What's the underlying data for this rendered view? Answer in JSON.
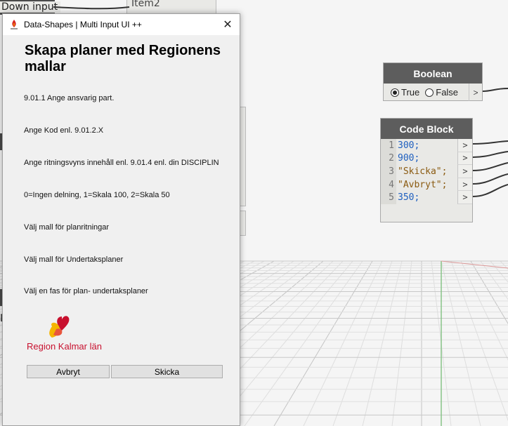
{
  "canvas": {
    "stub_labels": {
      "down_input_top": "Down input",
      "item_top": "Item2",
      "down_input_side": "Do"
    },
    "boolean_node": {
      "title": "Boolean",
      "true_label": "True",
      "false_label": "False",
      "selected": "True",
      "out_port": ">"
    },
    "code_block_node": {
      "title": "Code Block",
      "lines": [
        {
          "number": "1",
          "code": "300;",
          "kind": "num",
          "port": ">"
        },
        {
          "number": "2",
          "code": "900;",
          "kind": "num",
          "port": ">"
        },
        {
          "number": "3",
          "code": "\"Skicka\";",
          "kind": "str",
          "port": ">"
        },
        {
          "number": "4",
          "code": "\"Avbryt\";",
          "kind": "str",
          "port": ">"
        },
        {
          "number": "5",
          "code": "350;",
          "kind": "num",
          "port": ">"
        }
      ]
    }
  },
  "dialog": {
    "title": "Data-Shapes | Multi Input UI ++",
    "close_label": "✕",
    "heading": "Skapa planer med Regionens mallar",
    "fields": [
      "9.01.1 Ange ansvarig part.",
      "Ange Kod enl. 9.01.2.X",
      "Ange ritningsvyns innehåll enl. 9.01.4 enl. din DISCIPLIN",
      "0=Ingen delning, 1=Skala 100, 2=Skala 50",
      "Välj mall för planritningar",
      "Välj mall för Undertaksplaner",
      "Välj en fas för plan- undertaksplaner"
    ],
    "logo_text": "Region Kalmar län",
    "buttons": {
      "cancel": "Avbryt",
      "submit": "Skicka"
    }
  },
  "colors": {
    "brand_red": "#c8102e",
    "brand_yellow": "#f5b400",
    "node_header": "#5d5d5d"
  }
}
